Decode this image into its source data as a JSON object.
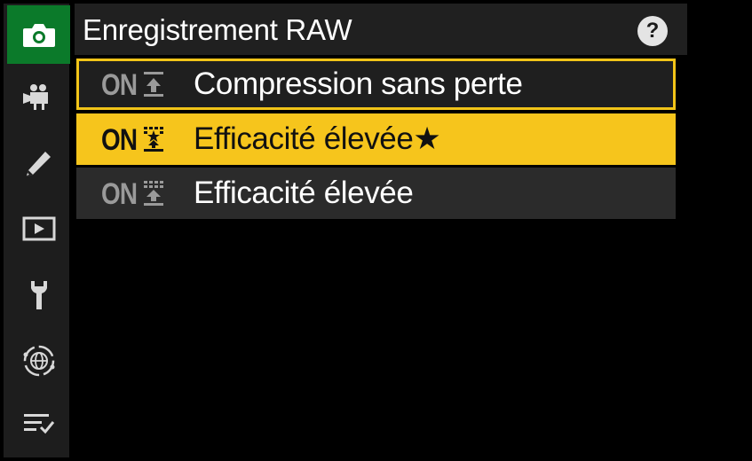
{
  "sidebar": {
    "tabs": [
      {
        "name": "photo-shooting-menu",
        "icon": "camera-icon",
        "active": true
      },
      {
        "name": "video-recording-menu",
        "icon": "movie-camera-icon",
        "active": false
      },
      {
        "name": "custom-settings-menu",
        "icon": "pencil-icon",
        "active": false
      },
      {
        "name": "playback-menu",
        "icon": "play-icon",
        "active": false
      },
      {
        "name": "setup-menu",
        "icon": "wrench-icon",
        "active": false
      },
      {
        "name": "network-menu",
        "icon": "network-globe-icon",
        "active": false
      },
      {
        "name": "my-menu",
        "icon": "checklist-icon",
        "active": false
      }
    ],
    "active_color": "#0b7a2a"
  },
  "header": {
    "title": "Enregistrement RAW",
    "help_label": "?"
  },
  "options": [
    {
      "on_label": "ON",
      "badge_icon": "lossless-compression-icon",
      "label": "Compression sans perte",
      "state": "current"
    },
    {
      "on_label": "ON",
      "badge_icon": "high-efficiency-star-icon",
      "label": "Efficacité élevée★",
      "state": "selected"
    },
    {
      "on_label": "ON",
      "badge_icon": "high-efficiency-icon",
      "label": "Efficacité élevée",
      "state": "normal"
    }
  ],
  "colors": {
    "highlight": "#f6c51c",
    "current_border": "#f2c418",
    "item_background": "#2b2b2b"
  }
}
